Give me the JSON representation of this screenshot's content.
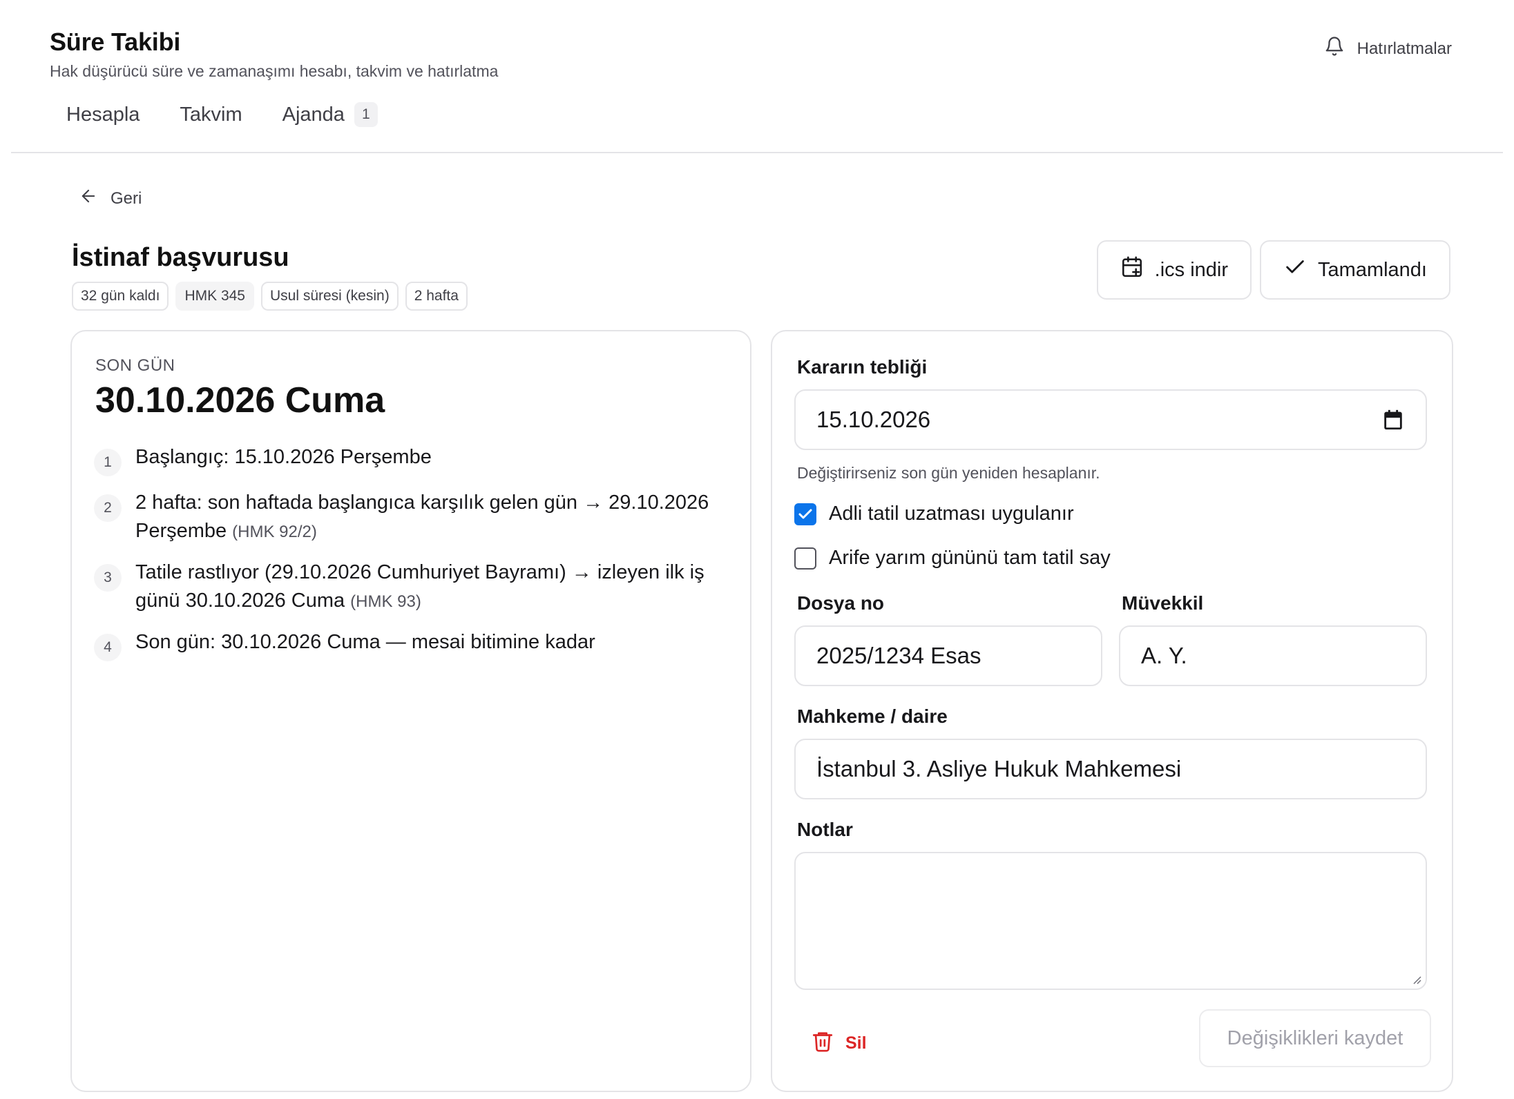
{
  "app": {
    "title": "Süre Takibi",
    "subtitle": "Hak düşürücü süre ve zamanaşımı hesabı, takvim ve hatırlatma",
    "reminders_label": "Hatırlatmalar"
  },
  "tabs": [
    {
      "label": "Hesapla"
    },
    {
      "label": "Takvim"
    },
    {
      "label": "Ajanda",
      "badge": "1"
    }
  ],
  "back_label": "Geri",
  "item": {
    "title": "İstinaf başvurusu",
    "badges": [
      "32 gün kaldı",
      "HMK 345",
      "Usul süresi (kesin)",
      "2 hafta"
    ]
  },
  "actions": {
    "ics_label": ".ics indir",
    "done_label": "Tamamlandı"
  },
  "result": {
    "label": "SON GÜN",
    "date": "30.10.2026 Cuma",
    "steps": [
      {
        "num": "1",
        "text": "Başlangıç: 15.10.2026 Perşembe",
        "ref": ""
      },
      {
        "num": "2",
        "text": "2 hafta: son haftada başlangıca karşılık gelen gün → 29.10.2026 Perşembe",
        "ref": "(HMK 92/2)"
      },
      {
        "num": "3",
        "text": "Tatile rastlıyor (29.10.2026 Cumhuriyet Bayramı) → izleyen ilk iş günü 30.10.2026 Cuma",
        "ref": "(HMK 93)"
      },
      {
        "num": "4",
        "text": "Son gün: 30.10.2026 Cuma — mesai bitimine kadar",
        "ref": ""
      }
    ]
  },
  "form": {
    "notification_label": "Kararın tebliği",
    "notification_value": "15.10.2026",
    "notification_hint": "Değiştirirseniz son gün yeniden hesaplanır.",
    "checkbox_holiday_label": "Adli tatil uzatması uygulanır",
    "checkbox_holiday_checked": true,
    "checkbox_eve_label": "Arife yarım gününü tam tatil say",
    "checkbox_eve_checked": false,
    "file_no_label": "Dosya no",
    "file_no_value": "2025/1234 Esas",
    "client_label": "Müvekkil",
    "client_value": "A. Y.",
    "court_label": "Mahkeme / daire",
    "court_value": "İstanbul 3. Asliye Hukuk Mahkemesi",
    "notes_label": "Notlar",
    "notes_value": "",
    "delete_label": "Sil",
    "save_label": "Değişiklikleri kaydet"
  },
  "colors": {
    "accent": "#0b74ea",
    "danger": "#dc2626",
    "border": "#e4e4e7"
  }
}
